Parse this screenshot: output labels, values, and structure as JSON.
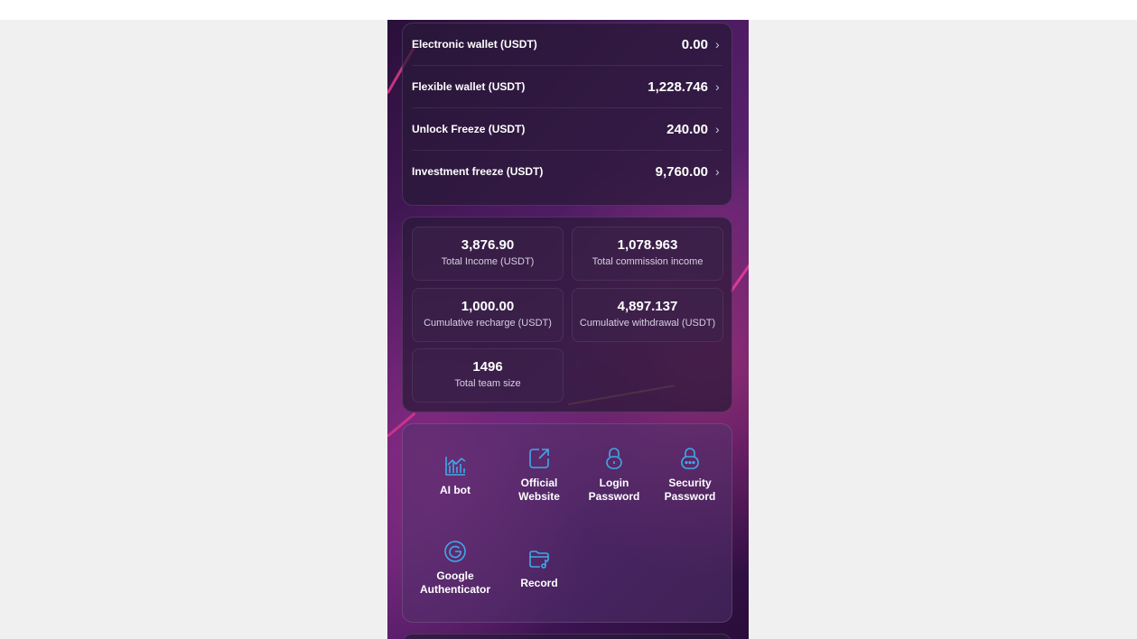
{
  "wallets": [
    {
      "label": "Electronic wallet (USDT)",
      "value": "0.00"
    },
    {
      "label": "Flexible wallet (USDT)",
      "value": "1,228.746"
    },
    {
      "label": "Unlock Freeze (USDT)",
      "value": "240.00"
    },
    {
      "label": "Investment freeze (USDT)",
      "value": "9,760.00"
    }
  ],
  "stats": [
    {
      "value": "3,876.90",
      "label": "Total Income (USDT)"
    },
    {
      "value": "1,078.963",
      "label": "Total commission income"
    },
    {
      "value": "1,000.00",
      "label": "Cumulative recharge (USDT)"
    },
    {
      "value": "4,897.137",
      "label": "Cumulative withdrawal (USDT)"
    },
    {
      "value": "1496",
      "label": "Total team size"
    }
  ],
  "menu": [
    {
      "label": "AI bot",
      "icon": "chart-icon"
    },
    {
      "label": "Official Website",
      "icon": "external-link-icon"
    },
    {
      "label": "Login Password",
      "icon": "lock-icon"
    },
    {
      "label": "Security Password",
      "icon": "lock-dots-icon"
    },
    {
      "label": "Google Authenticator",
      "icon": "google-icon"
    },
    {
      "label": "Record",
      "icon": "folder-icon"
    }
  ],
  "colors": {
    "icon_accent": "#3fa9e8",
    "card_bg": "#281937"
  }
}
